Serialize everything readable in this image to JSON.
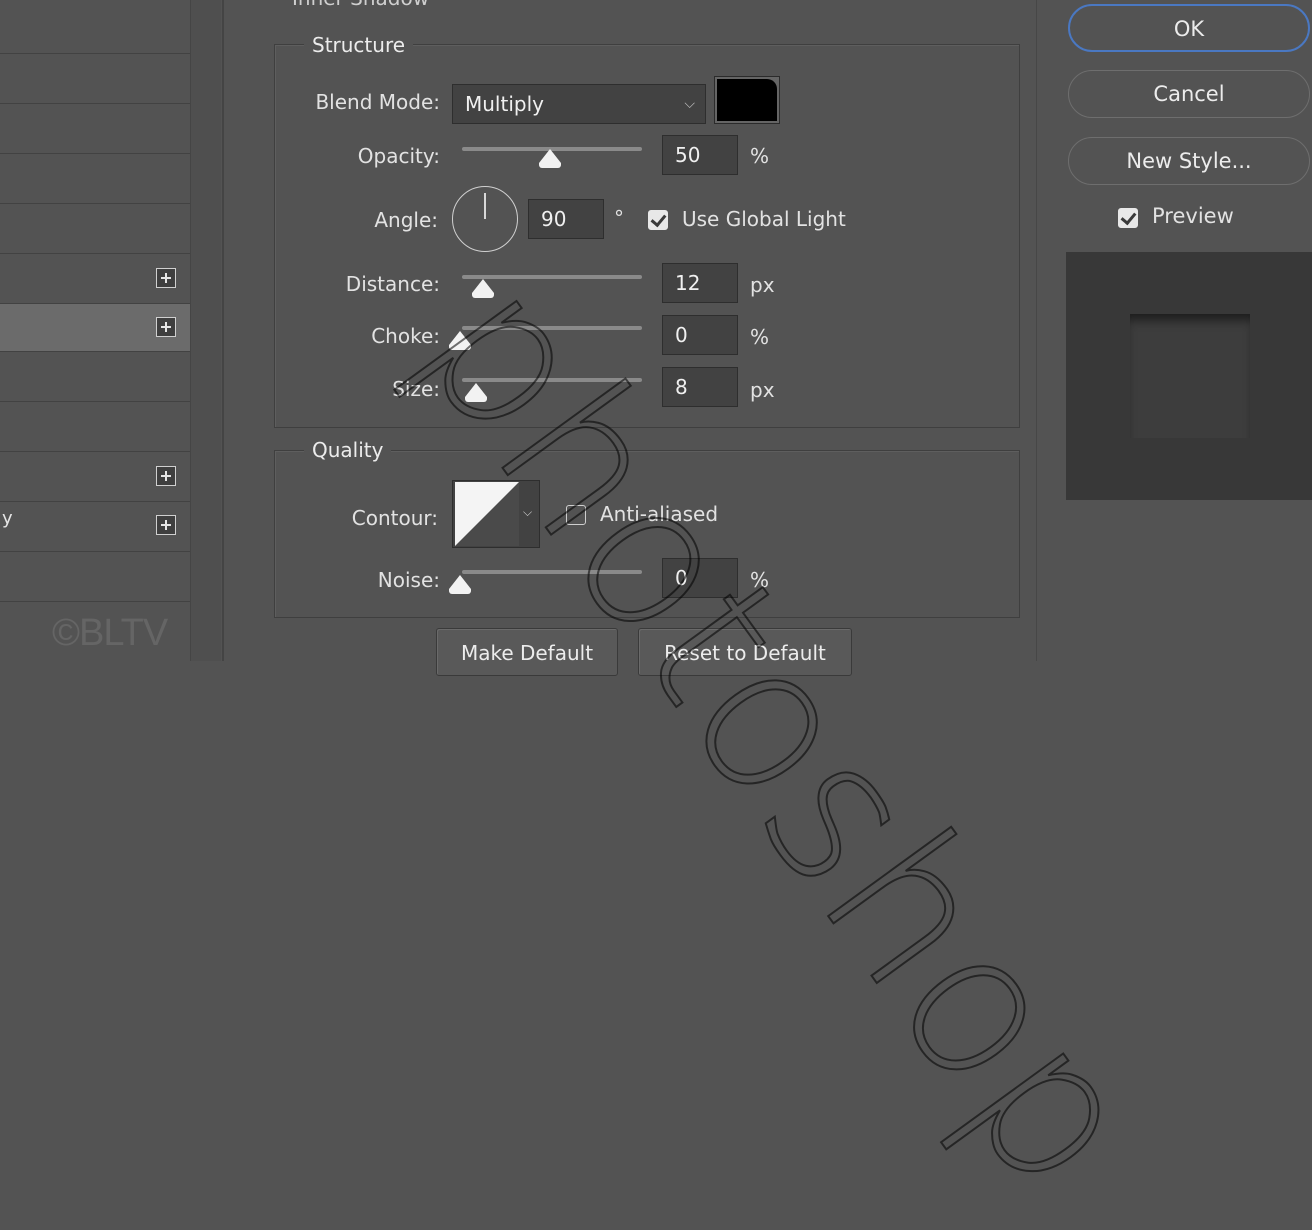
{
  "section_title": "Inner Shadow",
  "left_panel": {
    "rows": [
      "",
      "",
      "",
      "",
      "",
      "",
      "",
      "",
      "",
      "",
      "",
      "",
      ""
    ],
    "selected_row": 6,
    "stray_text": "y",
    "brand": "©BLTV"
  },
  "structure": {
    "legend": "Structure",
    "blend_mode_label": "Blend Mode:",
    "blend_mode_value": "Multiply",
    "shadow_color": "#000000",
    "opacity_label": "Opacity:",
    "opacity_value": "50",
    "opacity_unit": "%",
    "angle_label": "Angle:",
    "angle_value": "90",
    "angle_unit": "°",
    "use_global_light_label": "Use Global Light",
    "use_global_light_checked": true,
    "distance_label": "Distance:",
    "distance_value": "12",
    "distance_unit": "px",
    "choke_label": "Choke:",
    "choke_value": "0",
    "choke_unit": "%",
    "size_label": "Size:",
    "size_value": "8",
    "size_unit": "px"
  },
  "quality": {
    "legend": "Quality",
    "contour_label": "Contour:",
    "anti_aliased_label": "Anti-aliased",
    "anti_aliased_checked": false,
    "noise_label": "Noise:",
    "noise_value": "0",
    "noise_unit": "%"
  },
  "footer": {
    "make_default_label": "Make Default",
    "reset_default_label": "Reset to Default"
  },
  "right": {
    "ok_label": "OK",
    "cancel_label": "Cancel",
    "new_style_label": "New Style...",
    "preview_label": "Preview",
    "preview_checked": true
  },
  "watermark": "photoshop"
}
